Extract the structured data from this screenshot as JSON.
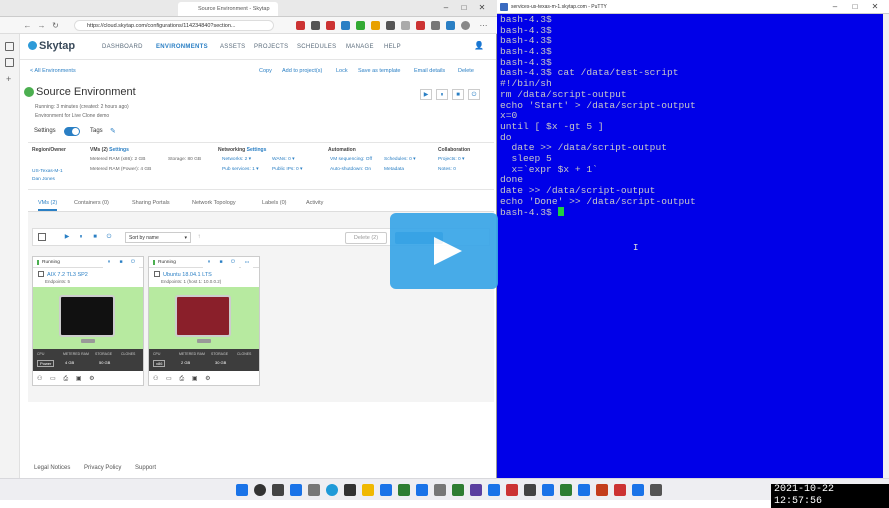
{
  "browser": {
    "tab_title": "Source Environment - Skytap",
    "url": "https://cloud.skytap.com/configurations/114234840?section..."
  },
  "app": {
    "logo": "Skytap",
    "nav": [
      "DASHBOARD",
      "ENVIRONMENTS",
      "ASSETS",
      "PROJECTS",
      "SCHEDULES",
      "MANAGE",
      "HELP"
    ],
    "active_nav": "ENVIRONMENTS"
  },
  "breadcrumb": "< All Environments",
  "actions": [
    "Copy",
    "Add to project(s)",
    "Lock",
    "Save as template",
    "Email details",
    "Delete"
  ],
  "environment": {
    "name": "Source Environment",
    "running": "Running: 3 minutes (created: 2 hours ago)",
    "description": "Environment for Live Clone demo",
    "settings_label": "Settings",
    "tags_label": "Tags"
  },
  "info": {
    "region": {
      "title": "Region/Owner",
      "lines": [
        "US-Texas-M-1",
        "Dan Jones"
      ]
    },
    "vms": {
      "title": "VMs (2)",
      "link": "Settings",
      "lines": [
        "Metered RAM (x86): 2 GB",
        "Metered RAM (Power): 4 GB"
      ],
      "storage": "Storage: 80 GB"
    },
    "networking": {
      "title": "Networking",
      "link": "Settings",
      "lines": [
        "Networks: 2 ▾",
        "Pub services: 1 ▾"
      ],
      "lines2": [
        "WANs: 0 ▾",
        "Public IPs: 0 ▾"
      ]
    },
    "automation": {
      "title": "Automation",
      "lines": [
        "VM sequencing: Off",
        "Auto-shutdown: On"
      ],
      "lines2": [
        "Schedules: 0 ▾",
        "Metadata"
      ]
    },
    "collaboration": {
      "title": "Collaboration",
      "lines": [
        "Projects: 0 ▾",
        "Notes: 0"
      ]
    }
  },
  "vm_tabs": [
    "VMs (2)",
    "Containers (0)",
    "Sharing Portals",
    "Network Topology",
    "Labels (0)",
    "Activity"
  ],
  "toolbar": {
    "sort": "Sort by name",
    "delete": "Delete (2)"
  },
  "vms": [
    {
      "status": "Running",
      "name": "AIX 7.2 TL3 SP2",
      "endpoints": "Endpoints: 5",
      "cpu": "Power",
      "ram": "4 GB",
      "storage": "50 GB",
      "screen_color": "#111111"
    },
    {
      "status": "Running",
      "name": "Ubuntu 18.04.1 LTS",
      "endpoints": "Endpoints: 1 (host 1: 10.0.0.2)",
      "cpu": "x86",
      "ram": "2 GB",
      "storage": "30 GB",
      "screen_color": "#8a1f2a"
    }
  ],
  "spec_headers": [
    "CPU",
    "METERED RAM",
    "STORAGE",
    "CLONES"
  ],
  "footer": [
    "Legal Notices",
    "Privacy Policy",
    "Support"
  ],
  "terminal": {
    "title": "services-us-texas-m-1.skytap.com - PuTTY",
    "lines": [
      "bash-4.3$",
      "bash-4.3$",
      "bash-4.3$",
      "bash-4.3$",
      "bash-4.3$",
      "bash-4.3$ cat /data/test-script",
      "#!/bin/sh",
      "rm /data/script-output",
      "echo 'Start' > /data/script-output",
      "x=0",
      "until [ $x -gt 5 ]",
      "do",
      "  date >> /data/script-output",
      "  sleep 5",
      "  x=`expr $x + 1`",
      "done",
      "date >> /data/script-output",
      "echo 'Done' >> /data/script-output"
    ],
    "prompt": "bash-4.3$ "
  },
  "clock": "2021-10-22 12:57:56"
}
